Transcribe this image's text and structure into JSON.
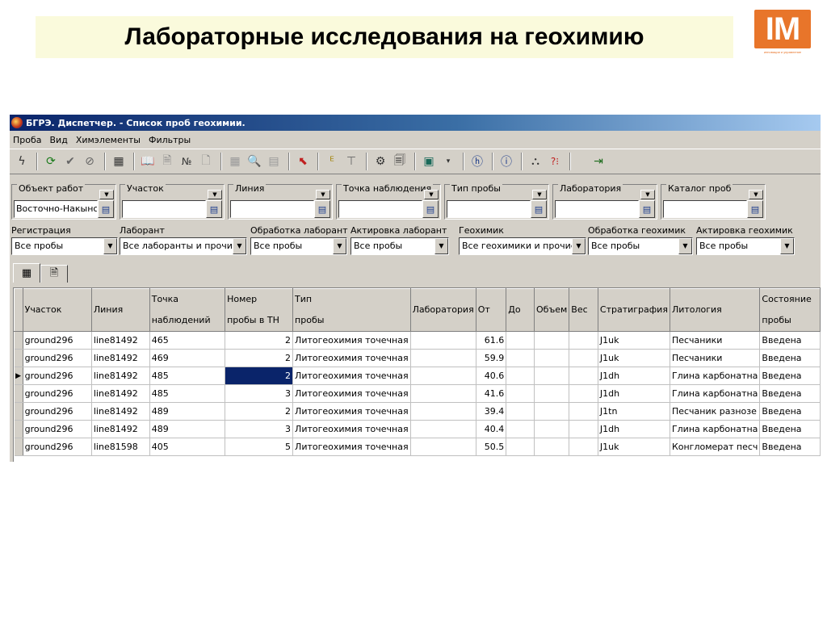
{
  "slide": {
    "title": "Лабораторные исследования на геохимию",
    "logo_text": "IM",
    "logo_tagline": "инновации и управление"
  },
  "window": {
    "title": "БГРЭ. Диспетчер. - Список проб геохимии."
  },
  "menu": [
    "Проба",
    "Вид",
    "Химэлементы",
    "Фильтры"
  ],
  "toolbar": {
    "no_label": "№"
  },
  "filters_top": [
    {
      "label": "Объект работ",
      "value": "Восточно-Накынск"
    },
    {
      "label": "Участок",
      "value": ""
    },
    {
      "label": "Линия",
      "value": ""
    },
    {
      "label": "Точка наблюдения",
      "value": ""
    },
    {
      "label": "Тип пробы",
      "value": ""
    },
    {
      "label": "Лаборатория",
      "value": ""
    },
    {
      "label": "Каталог проб",
      "value": ""
    }
  ],
  "filters_bottom": [
    {
      "label": "Регистрация",
      "value": "Все пробы"
    },
    {
      "label": "Лаборант",
      "value": "Все лаборанты и прочие"
    },
    {
      "label": "Обработка лаборант",
      "value": "Все пробы"
    },
    {
      "label": "Актировка лаборант",
      "value": "Все пробы"
    },
    {
      "label": "Геохимик",
      "value": "Все геохимики и прочие"
    },
    {
      "label": "Обработка геохимик",
      "value": "Все пробы"
    },
    {
      "label": "Актировка геохимик",
      "value": "Все пробы"
    }
  ],
  "table": {
    "headers": [
      {
        "top": "",
        "bottom": "Участок"
      },
      {
        "top": "",
        "bottom": "Линия"
      },
      {
        "top": "Точка",
        "bottom": "наблюдений"
      },
      {
        "top": "Номер",
        "bottom": "пробы в ТН"
      },
      {
        "top": "Тип",
        "bottom": "пробы"
      },
      {
        "top": "",
        "bottom": "Лаборатория"
      },
      {
        "top": "",
        "bottom": "От"
      },
      {
        "top": "",
        "bottom": "До"
      },
      {
        "top": "",
        "bottom": "Объем"
      },
      {
        "top": "",
        "bottom": "Вес"
      },
      {
        "top": "",
        "bottom": "Стратиграфия"
      },
      {
        "top": "",
        "bottom": "Литология"
      },
      {
        "top": "Состояние",
        "bottom": "пробы"
      }
    ],
    "rows": [
      [
        "ground296",
        "line81492",
        "465",
        "2",
        "Литогеохимия точечная",
        "",
        "61.6",
        "",
        "",
        "",
        "J1uk",
        "Песчаники",
        "Введена"
      ],
      [
        "ground296",
        "line81492",
        "469",
        "2",
        "Литогеохимия точечная",
        "",
        "59.9",
        "",
        "",
        "",
        "J1uk",
        "Песчаники",
        "Введена"
      ],
      [
        "ground296",
        "line81492",
        "485",
        "2",
        "Литогеохимия точечная",
        "",
        "40.6",
        "",
        "",
        "",
        "J1dh",
        "Глина карбонатна",
        "Введена"
      ],
      [
        "ground296",
        "line81492",
        "485",
        "3",
        "Литогеохимия точечная",
        "",
        "41.6",
        "",
        "",
        "",
        "J1dh",
        "Глина карбонатна",
        "Введена"
      ],
      [
        "ground296",
        "line81492",
        "489",
        "2",
        "Литогеохимия точечная",
        "",
        "39.4",
        "",
        "",
        "",
        "J1tn",
        "Песчаник разнозе",
        "Введена"
      ],
      [
        "ground296",
        "line81492",
        "489",
        "3",
        "Литогеохимия точечная",
        "",
        "40.4",
        "",
        "",
        "",
        "J1dh",
        "Глина карбонатна",
        "Введена"
      ],
      [
        "ground296",
        "line81598",
        "405",
        "5",
        "Литогеохимия точечная",
        "",
        "50.5",
        "",
        "",
        "",
        "J1uk",
        "Конгломерат песч",
        "Введена"
      ]
    ],
    "selected_row": 2
  },
  "colors": {
    "title_bg": "#fafadc",
    "logo": "#e8752a",
    "selection": "#0a246a",
    "window_bg": "#d4d0c8"
  }
}
